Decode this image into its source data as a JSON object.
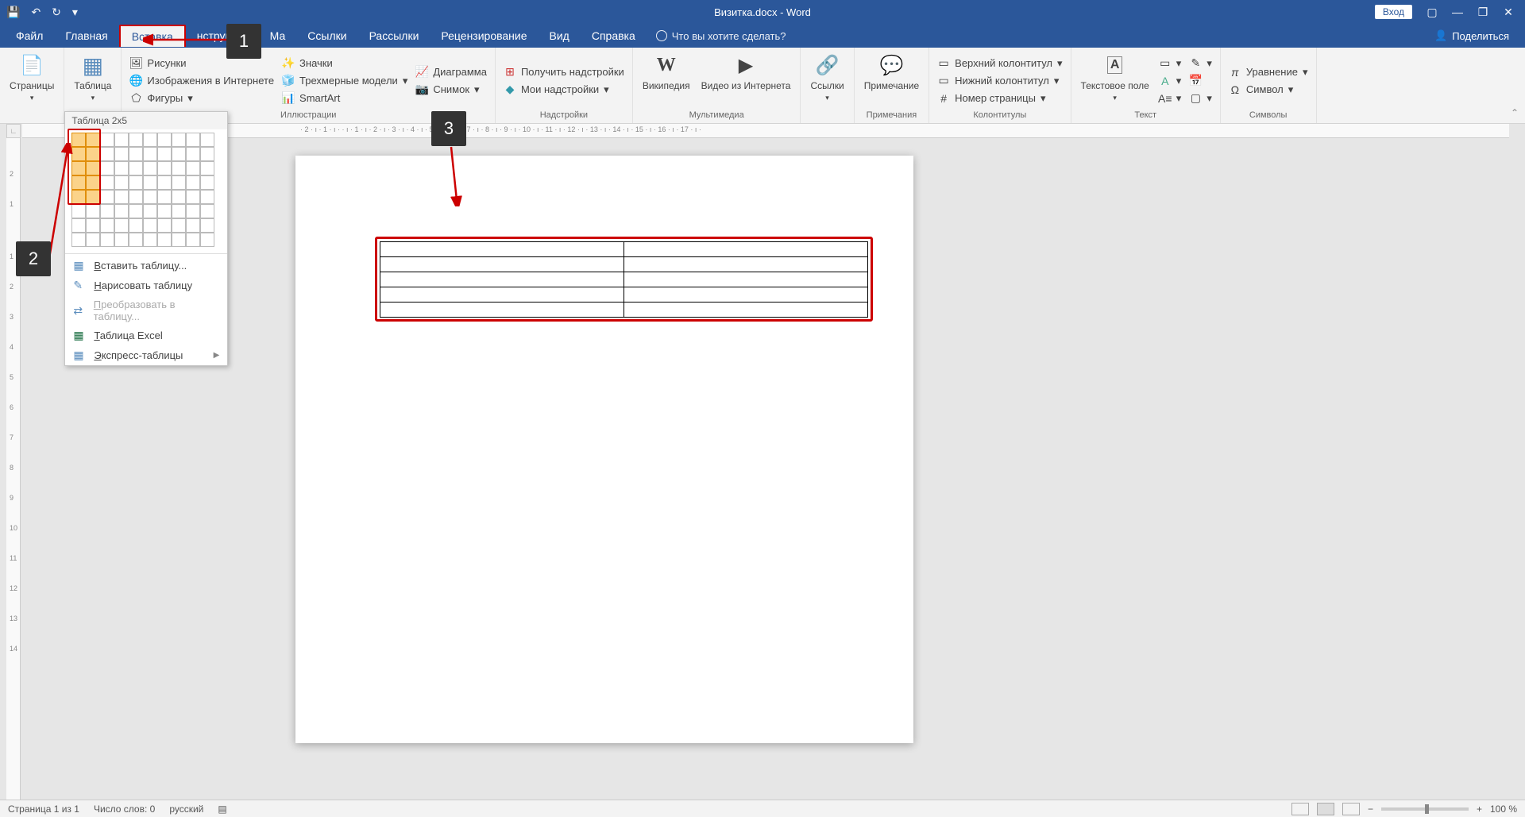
{
  "title": "Визитка.docx - Word",
  "qat": {
    "save": "💾",
    "undo": "↶",
    "redo": "↻",
    "custom": "▾"
  },
  "titlebar_right": {
    "login": "Вход"
  },
  "tabs": {
    "file": "Файл",
    "home": "Главная",
    "insert": "Вставка",
    "design": "нструктор",
    "layout": "Ма",
    "references": "Ссылки",
    "mailings": "Рассылки",
    "review": "Рецензирование",
    "view": "Вид",
    "help": "Справка",
    "tellme": "Что вы хотите сделать?",
    "share": "Поделиться"
  },
  "ribbon": {
    "pages": {
      "label": "Страницы",
      "btn": "Страницы"
    },
    "tables": {
      "label": "",
      "btn": "Таблица"
    },
    "illustrations": {
      "label": "Иллюстрации",
      "pictures": "Рисунки",
      "online_pics": "Изображения в Интернете",
      "shapes": "Фигуры",
      "icons": "Значки",
      "models3d": "Трехмерные модели",
      "smartart": "SmartArt",
      "chart": "Диаграмма",
      "screenshot": "Снимок"
    },
    "addins": {
      "label": "Надстройки",
      "get": "Получить надстройки",
      "my": "Мои надстройки"
    },
    "media": {
      "label": "Мультимедиа",
      "wiki": "Википедия",
      "video": "Видео из Интернета"
    },
    "links": {
      "label": "",
      "btn": "Ссылки"
    },
    "comments": {
      "label": "Примечания",
      "btn": "Примечание"
    },
    "headers": {
      "label": "Колонтитулы",
      "header": "Верхний колонтитул",
      "footer": "Нижний колонтитул",
      "pagenum": "Номер страницы"
    },
    "text": {
      "label": "Текст",
      "textbox": "Текстовое поле"
    },
    "symbols": {
      "label": "Символы",
      "equation": "Уравнение",
      "symbol": "Символ"
    }
  },
  "table_dropdown": {
    "title": "Таблица 2x5",
    "cols": 2,
    "rows": 5,
    "grid_cols": 10,
    "grid_rows": 8,
    "insert": "Вставить таблицу...",
    "draw": "Нарисовать таблицу",
    "convert": "Преобразовать в таблицу...",
    "excel": "Таблица Excel",
    "quick": "Экспресс-таблицы"
  },
  "ruler_h": "· 2 · ı · 1 · ı ·   · ı · 1 · ı · 2 · ı · 3 · ı · 4 · ı · 5 · ı · 6 · ı · 7 · ı · 8 · ı · 9 · ı · 10 · ı · 11 · ı · 12 · ı · 13 · ı · 14 · ı · 15 · ı · 16 · ı · 17 · ı ·",
  "ruler_v": [
    "2",
    "1",
    "",
    "1",
    "2",
    "3",
    "4",
    "5",
    "6",
    "7",
    "8",
    "9",
    "10",
    "11",
    "12",
    "13",
    "14"
  ],
  "callouts": {
    "c1": "1",
    "c2": "2",
    "c3": "3"
  },
  "status": {
    "page": "Страница 1 из 1",
    "words": "Число слов: 0",
    "lang": "русский",
    "zoom": "100 %"
  }
}
